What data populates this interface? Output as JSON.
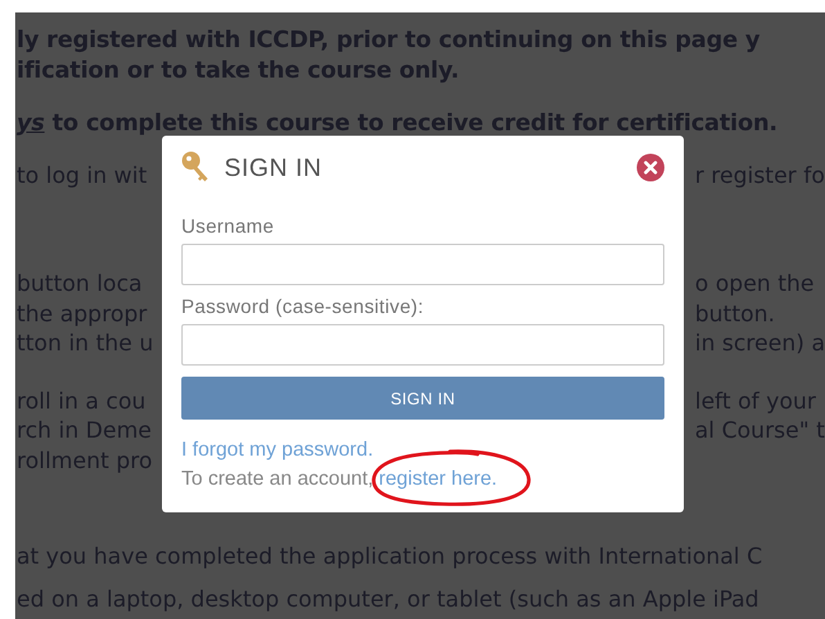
{
  "background": {
    "paragraphs": [
      {
        "kind": "bold",
        "lines": [
          {
            "left": "ly registered with ICCDP, prior to continuing on this page y"
          },
          {
            "left": "ification or to take the course only."
          }
        ]
      },
      {
        "kind": "bold",
        "lines": [
          {
            "underlined_lead": "ys",
            "left": " to complete this course to receive credit for certification."
          }
        ]
      },
      {
        "kind": "body",
        "lines": [
          {
            "left": "to log in wit",
            "right": "r register fo"
          }
        ]
      },
      {
        "kind": "body",
        "lines": [
          {
            "left": "button loca",
            "right": "o open the"
          },
          {
            "left": "the appropr",
            "right": "button."
          },
          {
            "left": "tton in the u",
            "right": "in screen) a"
          }
        ]
      },
      {
        "kind": "body",
        "lines": [
          {
            "left": "roll in a cou",
            "right": "left of your"
          },
          {
            "left": "rch in Deme",
            "right": "al Course\" t"
          },
          {
            "left": "rollment pro"
          }
        ]
      },
      {
        "kind": "body",
        "lines": [
          {
            "left": "at you have completed the application process with International C"
          }
        ]
      },
      {
        "kind": "body",
        "lines": [
          {
            "left": "ed on a laptop, desktop computer, or tablet (such as an Apple iPad"
          }
        ]
      }
    ]
  },
  "dialog": {
    "title": "SIGN IN",
    "fields": [
      {
        "label": "Username"
      },
      {
        "label": "Password (case-sensitive):"
      }
    ],
    "submit": "SIGN IN",
    "forgot_link": "I forgot my password.",
    "register_prompt": "To create an account,",
    "register_link": "register here.",
    "register_circled": true
  }
}
